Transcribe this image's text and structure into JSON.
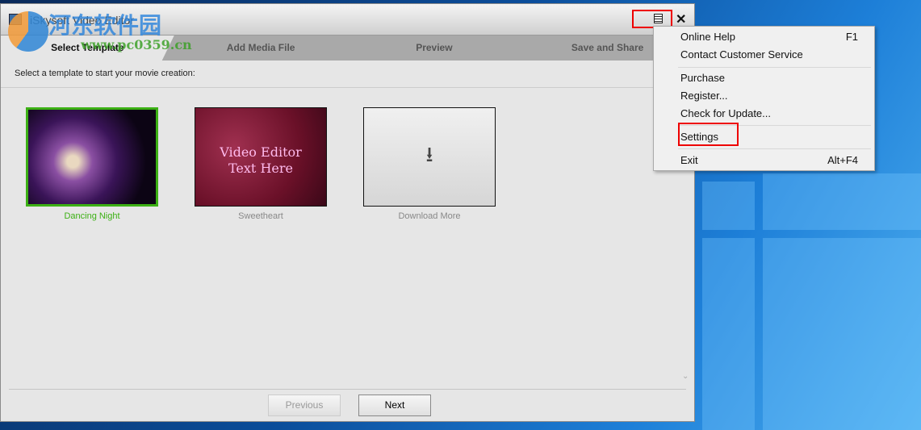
{
  "window": {
    "title": "iSkysoft Video Editor"
  },
  "tabs": [
    {
      "label": "Select Template",
      "active": true
    },
    {
      "label": "Add Media File"
    },
    {
      "label": "Preview"
    },
    {
      "label": "Save and Share"
    }
  ],
  "instruction": "Select a template to start your movie creation:",
  "templates": [
    {
      "label": "Dancing Night",
      "selected": true
    },
    {
      "label": "Sweetheart",
      "thumb_text": [
        "Video Editor",
        "Text Here"
      ]
    },
    {
      "label": "Download More"
    }
  ],
  "footer": {
    "previous": "Previous",
    "next": "Next"
  },
  "menu": {
    "items": [
      {
        "label": "Online Help",
        "shortcut": "F1"
      },
      {
        "label": "Contact Customer Service",
        "shortcut": ""
      },
      {
        "label": "Purchase",
        "shortcut": ""
      },
      {
        "label": "Register...",
        "shortcut": ""
      },
      {
        "label": "Check for Update...",
        "shortcut": ""
      },
      {
        "label": "Settings",
        "shortcut": "",
        "highlighted": true
      },
      {
        "label": "Exit",
        "shortcut": "Alt+F4"
      }
    ]
  },
  "watermark": {
    "text": "河东软件园",
    "url_text": "www.pc0359.cn"
  },
  "colors": {
    "selected": "#3cb014",
    "highlight_box": "#e00000"
  }
}
